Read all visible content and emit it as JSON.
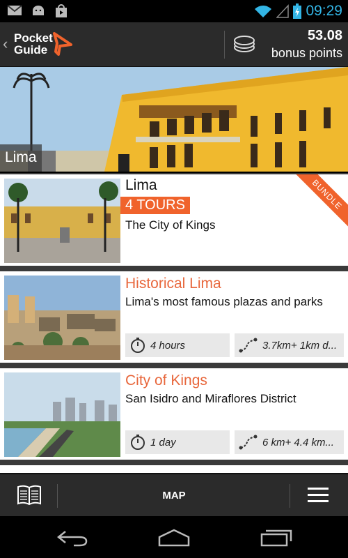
{
  "status_bar": {
    "time": "09:29"
  },
  "header": {
    "logo_line1": "Pocket",
    "logo_line2": "Guide",
    "points_value": "53.08",
    "points_label": "bonus points"
  },
  "hero": {
    "city": "Lima"
  },
  "cards": [
    {
      "title": "Lima",
      "badge": "4 TOURS",
      "subtitle": "The City of Kings",
      "ribbon": "BUNDLE"
    },
    {
      "title": "Historical Lima",
      "subtitle": "Lima's most famous plazas and parks",
      "duration": "4 hours",
      "distance": "3.7km+ 1km d..."
    },
    {
      "title": "City of Kings",
      "subtitle": "San Isidro and Miraflores District",
      "duration": "1 day",
      "distance": "6 km+ 4.4 km..."
    }
  ],
  "bottom_bar": {
    "map_label": "MAP"
  },
  "icons": {
    "status": [
      "gmail-icon",
      "android-icon",
      "shopping-bag-icon",
      "wifi-icon",
      "signal-icon",
      "battery-charging-icon"
    ],
    "header": [
      "back-chevron-icon",
      "coins-icon"
    ],
    "bottom": [
      "book-icon",
      "menu-icon"
    ],
    "nav": [
      "back-icon",
      "home-icon",
      "recents-icon"
    ]
  },
  "colors": {
    "accent": "#f0632c",
    "title_orange": "#e8673c",
    "status_blue": "#33b5e5",
    "bar_bg": "#2b2b2b"
  }
}
